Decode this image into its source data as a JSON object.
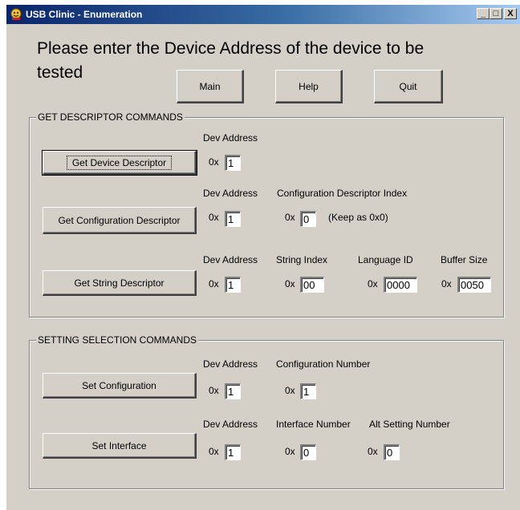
{
  "window": {
    "title": "USB Clinic - Enumeration",
    "controls": {
      "minimize": "_",
      "maximize": "□",
      "close": "X"
    }
  },
  "heading": "Please enter the Device Address of the device to be tested",
  "nav": {
    "main": "Main",
    "help": "Help",
    "quit": "Quit"
  },
  "get_descriptor": {
    "group_title": "GET DESCRIPTOR COMMANDS",
    "device": {
      "button": "Get Device Descriptor",
      "dev_address_label": "Dev Address",
      "prefix": "0x",
      "dev_address_value": "1"
    },
    "configuration": {
      "button": "Get Configuration Descriptor",
      "dev_address_label": "Dev Address",
      "index_label": "Configuration Descriptor Index",
      "prefix": "0x",
      "dev_address_value": "1",
      "index_value": "0",
      "note": "(Keep as 0x0)"
    },
    "string": {
      "button": "Get String Descriptor",
      "dev_address_label": "Dev Address",
      "string_index_label": "String Index",
      "language_id_label": "Language ID",
      "buffer_size_label": "Buffer Size",
      "prefix": "0x",
      "dev_address_value": "1",
      "string_index_value": "00",
      "language_id_value": "0000",
      "buffer_size_value": "0050"
    }
  },
  "setting_selection": {
    "group_title": "SETTING SELECTION COMMANDS",
    "set_configuration": {
      "button": "Set Configuration",
      "dev_address_label": "Dev Address",
      "config_number_label": "Configuration Number",
      "prefix": "0x",
      "dev_address_value": "1",
      "config_number_value": "1"
    },
    "set_interface": {
      "button": "Set Interface",
      "dev_address_label": "Dev Address",
      "interface_number_label": "Interface Number",
      "alt_setting_label": "Alt Setting Number",
      "prefix": "0x",
      "dev_address_value": "1",
      "interface_number_value": "0",
      "alt_setting_value": "0"
    }
  }
}
